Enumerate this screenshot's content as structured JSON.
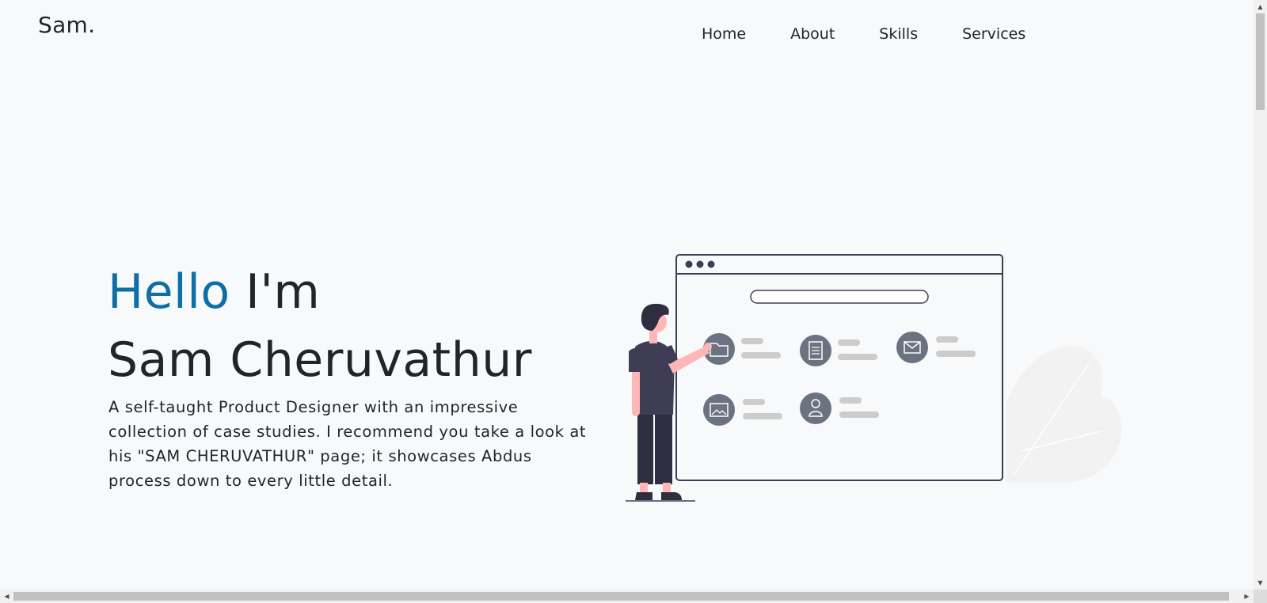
{
  "header": {
    "brand": "Sam.",
    "nav": [
      "Home",
      "About",
      "Skills",
      "Services"
    ]
  },
  "hero": {
    "greeting": "Hello",
    "intro": "I'm",
    "name": "Sam Cheruvathur",
    "description": "A self-taught Product Designer with an impressive collection of case studies. I recommend you take a look at his \"SAM CHERUVATHUR\" page; it showcases Abdus process down to every little detail."
  },
  "colors": {
    "accent": "#0e6fa7",
    "text": "#212529",
    "background": "#f8f9fa",
    "illustration_icon": "#6b7280",
    "illustration_line": "#3f3d56",
    "illustration_skin": "#ffb6b6"
  },
  "illustration": {
    "icons": [
      "folder-icon",
      "document-icon",
      "mail-icon",
      "image-icon",
      "user-icon"
    ]
  }
}
